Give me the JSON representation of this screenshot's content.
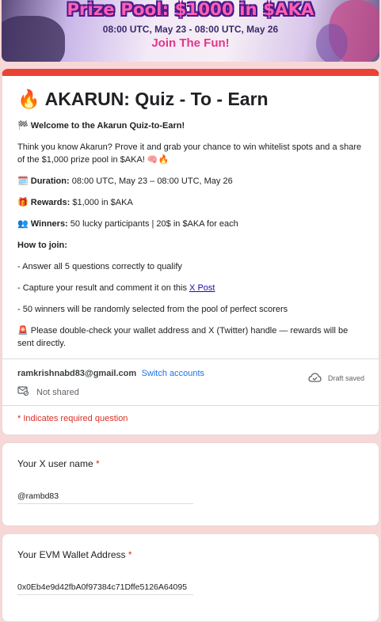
{
  "banner": {
    "title": "Prize Pool: $1000 in $AKA",
    "dates": "08:00 UTC, May 23 - 08:00 UTC, May 26",
    "cta": "Join The Fun!"
  },
  "form": {
    "title_emoji": "🔥",
    "title": "AKARUN: Quiz - To - Earn",
    "welcome_emoji": "🏁",
    "welcome": "Welcome to the Akarun Quiz-to-Earn!",
    "intro": "Think you know Akarun? Prove it and grab your chance to win whitelist spots and a share of the $1,000 prize pool in $AKA! 🧠🔥",
    "duration_emoji": "🗓️",
    "duration_label": "Duration:",
    "duration_value": " 08:00 UTC, May 23 – 08:00 UTC, May 26",
    "rewards_emoji": "🎁",
    "rewards_label": "Rewards:",
    "rewards_value": " $1,000 in $AKA",
    "winners_emoji": "👥",
    "winners_label": "Winners:",
    "winners_value": " 50 lucky participants | 20$ in $AKA for each",
    "how_to_join": "How to join:",
    "step1": "- Answer all 5 questions correctly to qualify",
    "step2_prefix": "- Capture your result and comment it on this ",
    "step2_link": "X Post",
    "step3": "- 50 winners will be randomly selected from the pool of perfect scorers",
    "warning_emoji": "🚨",
    "warning": " Please double-check your wallet address and X (Twitter) handle — rewards will be sent directly."
  },
  "account": {
    "email": "ramkrishnabd83@gmail.com",
    "switch": "Switch accounts",
    "shared": "Not shared",
    "draft": "Draft saved"
  },
  "required_note": "* Indicates required question",
  "questions": [
    {
      "label": "Your X user name",
      "star": "*",
      "value": "@rambd83"
    },
    {
      "label": "Your EVM Wallet Address",
      "star": "*",
      "value": "0x0Eb4e9d42fbA0f97384c71Dffe5126A64095"
    }
  ],
  "colors": {
    "accent": "#ea4335",
    "link": "#1a73e8",
    "background": "#f8d7d7"
  }
}
